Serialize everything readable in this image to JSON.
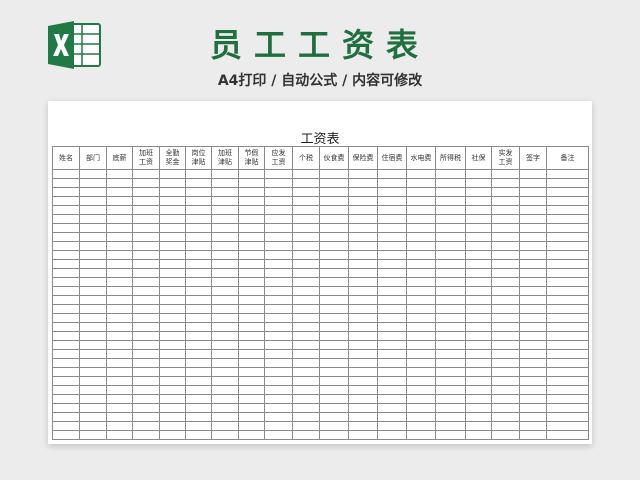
{
  "header": {
    "title": "员工工资表",
    "subtitle": "A4打印 / 自动公式 / 内容可修改",
    "logo_icon": "excel-icon",
    "brand_color": "#1f6f3f"
  },
  "sheet": {
    "title": "工资表",
    "columns": [
      "姓名",
      "部门",
      "底薪",
      "加班\n工资",
      "全勤\n奖金",
      "岗位\n津贴",
      "加班\n津贴",
      "节假\n津贴",
      "应发\n工资",
      "个税",
      "伙食费",
      "保险费",
      "住宿费",
      "水电费",
      "所得税",
      "社保",
      "实发\n工资",
      "签字",
      "备注"
    ],
    "empty_row_count": 30
  }
}
